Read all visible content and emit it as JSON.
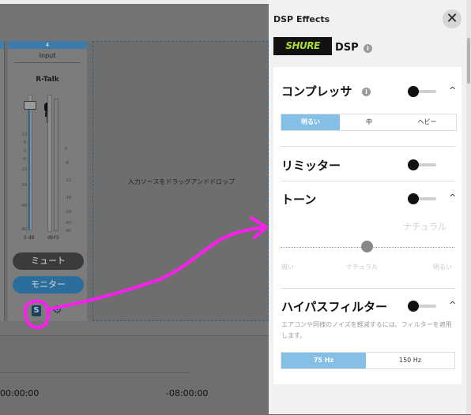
{
  "mixer": {
    "channel_number": "4",
    "channel_type": "Input",
    "channel_name": "R-Talk",
    "fader_scale": [
      "12",
      "6",
      "0",
      "-6",
      "-12",
      "-24",
      "-48",
      "-60"
    ],
    "meter_scale": [
      "0",
      "-6",
      "-12",
      "-18",
      "-24",
      "-42",
      "-60"
    ],
    "fader_unit": "0 dB",
    "meter_unit": "dbFS",
    "mute_label": "ミュート",
    "monitor_label": "モニター",
    "dsp_icon_glyph": "S",
    "gear_icon_glyph": "⚙",
    "drop_zone_text": "入力ソースをドラッグアンドドロップ"
  },
  "timeline": {
    "time_left": "00:00:00",
    "time_right": "-08:00:00"
  },
  "dsp_panel": {
    "title": "DSP Effects",
    "close_glyph": "✕",
    "logo_text": "SHURE",
    "dsp_label": "DSP",
    "info_glyph": "i",
    "compressor": {
      "title": "コンプレッサ",
      "options": [
        "明るい",
        "中",
        "ヘビー"
      ],
      "selected_index": 0
    },
    "limiter": {
      "title": "リミッター"
    },
    "tone": {
      "title": "トーン",
      "current_value": "ナチュラル",
      "scale_labels": [
        "暗い",
        "ナチュラル",
        "明るい"
      ],
      "slider_position": 0.5
    },
    "highpass": {
      "title": "ハイパスフィルター",
      "description": "エアコンや同様のノイズを軽減するには、フィルターを適用します。",
      "options": [
        "75 Hz",
        "150 Hz"
      ],
      "selected_index": 0
    },
    "chevron_glyph": "^"
  },
  "colors": {
    "accent_blue": "#86bfe6",
    "logo_green": "#a9de2e",
    "annotation_magenta": "#ff1df0"
  }
}
